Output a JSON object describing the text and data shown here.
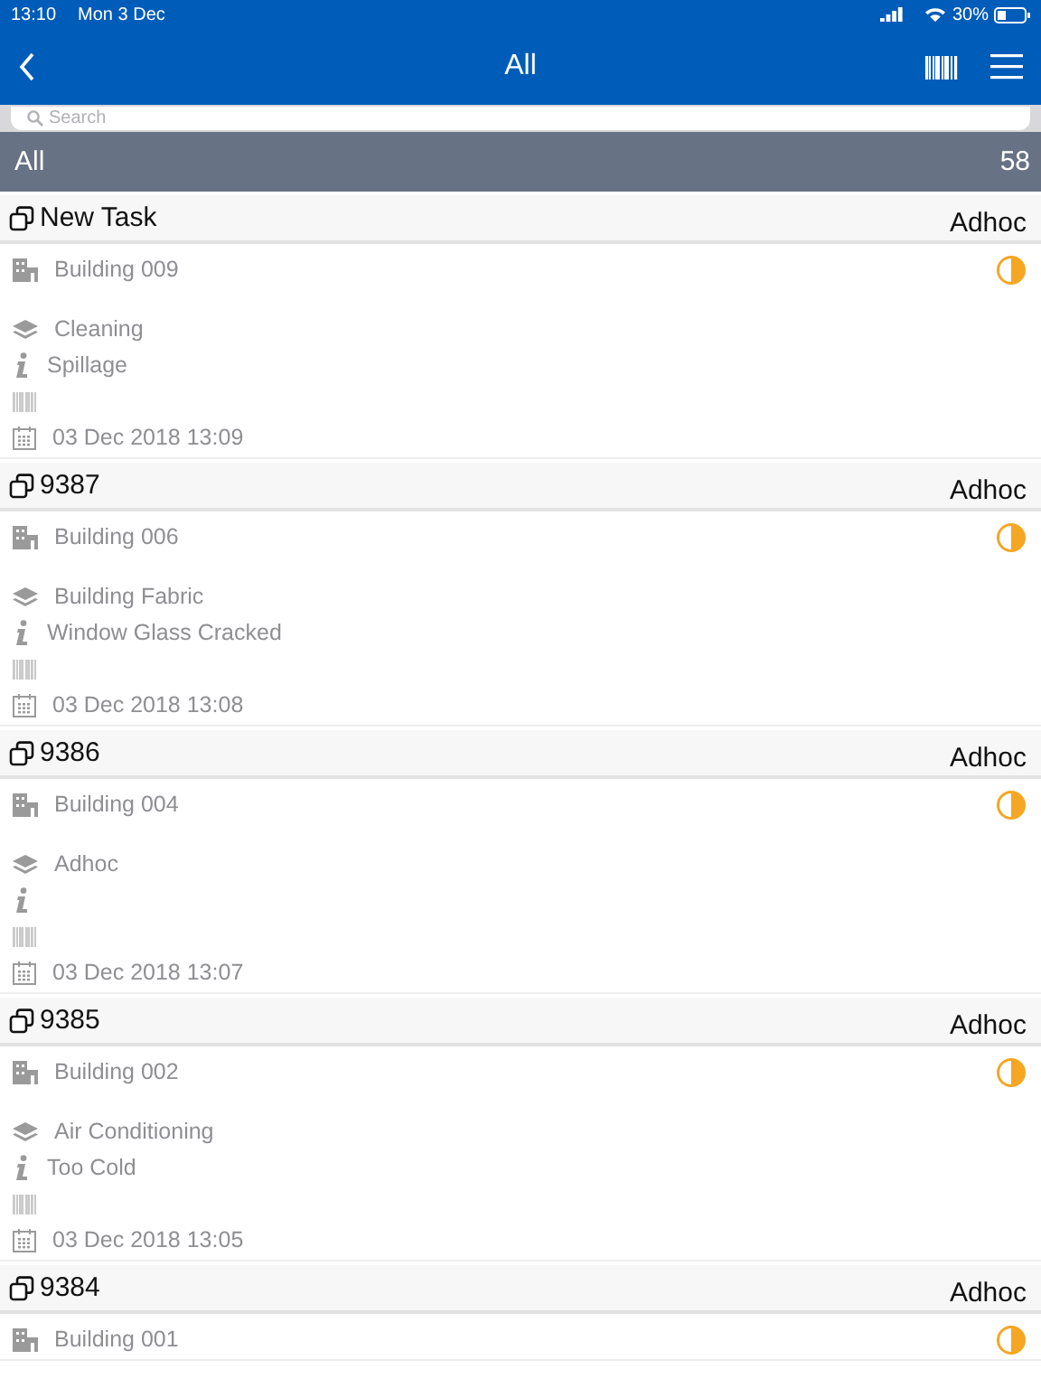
{
  "status_bar": {
    "time": "13:10",
    "date": "Mon 3 Dec",
    "battery": "30%"
  },
  "nav": {
    "title": "All"
  },
  "search": {
    "placeholder": "Search"
  },
  "section": {
    "title": "All",
    "count": "58"
  },
  "tasks": [
    {
      "title": "New Task",
      "type": "Adhoc",
      "building": "Building 009",
      "category": "Cleaning",
      "description": "Spillage",
      "date": "03 Dec 2018 13:09"
    },
    {
      "title": "9387",
      "type": "Adhoc",
      "building": "Building 006",
      "category": "Building Fabric",
      "description": "Window Glass Cracked",
      "date": "03 Dec 2018 13:08"
    },
    {
      "title": "9386",
      "type": "Adhoc",
      "building": "Building 004",
      "category": "Adhoc",
      "date": "03 Dec 2018 13:07"
    },
    {
      "title": "9385",
      "type": "Adhoc",
      "building": "Building 002",
      "category": "Air Conditioning",
      "description": "Too Cold",
      "date": "03 Dec 2018 13:05"
    },
    {
      "title": "9384",
      "type": "Adhoc",
      "building": "Building 001"
    }
  ]
}
